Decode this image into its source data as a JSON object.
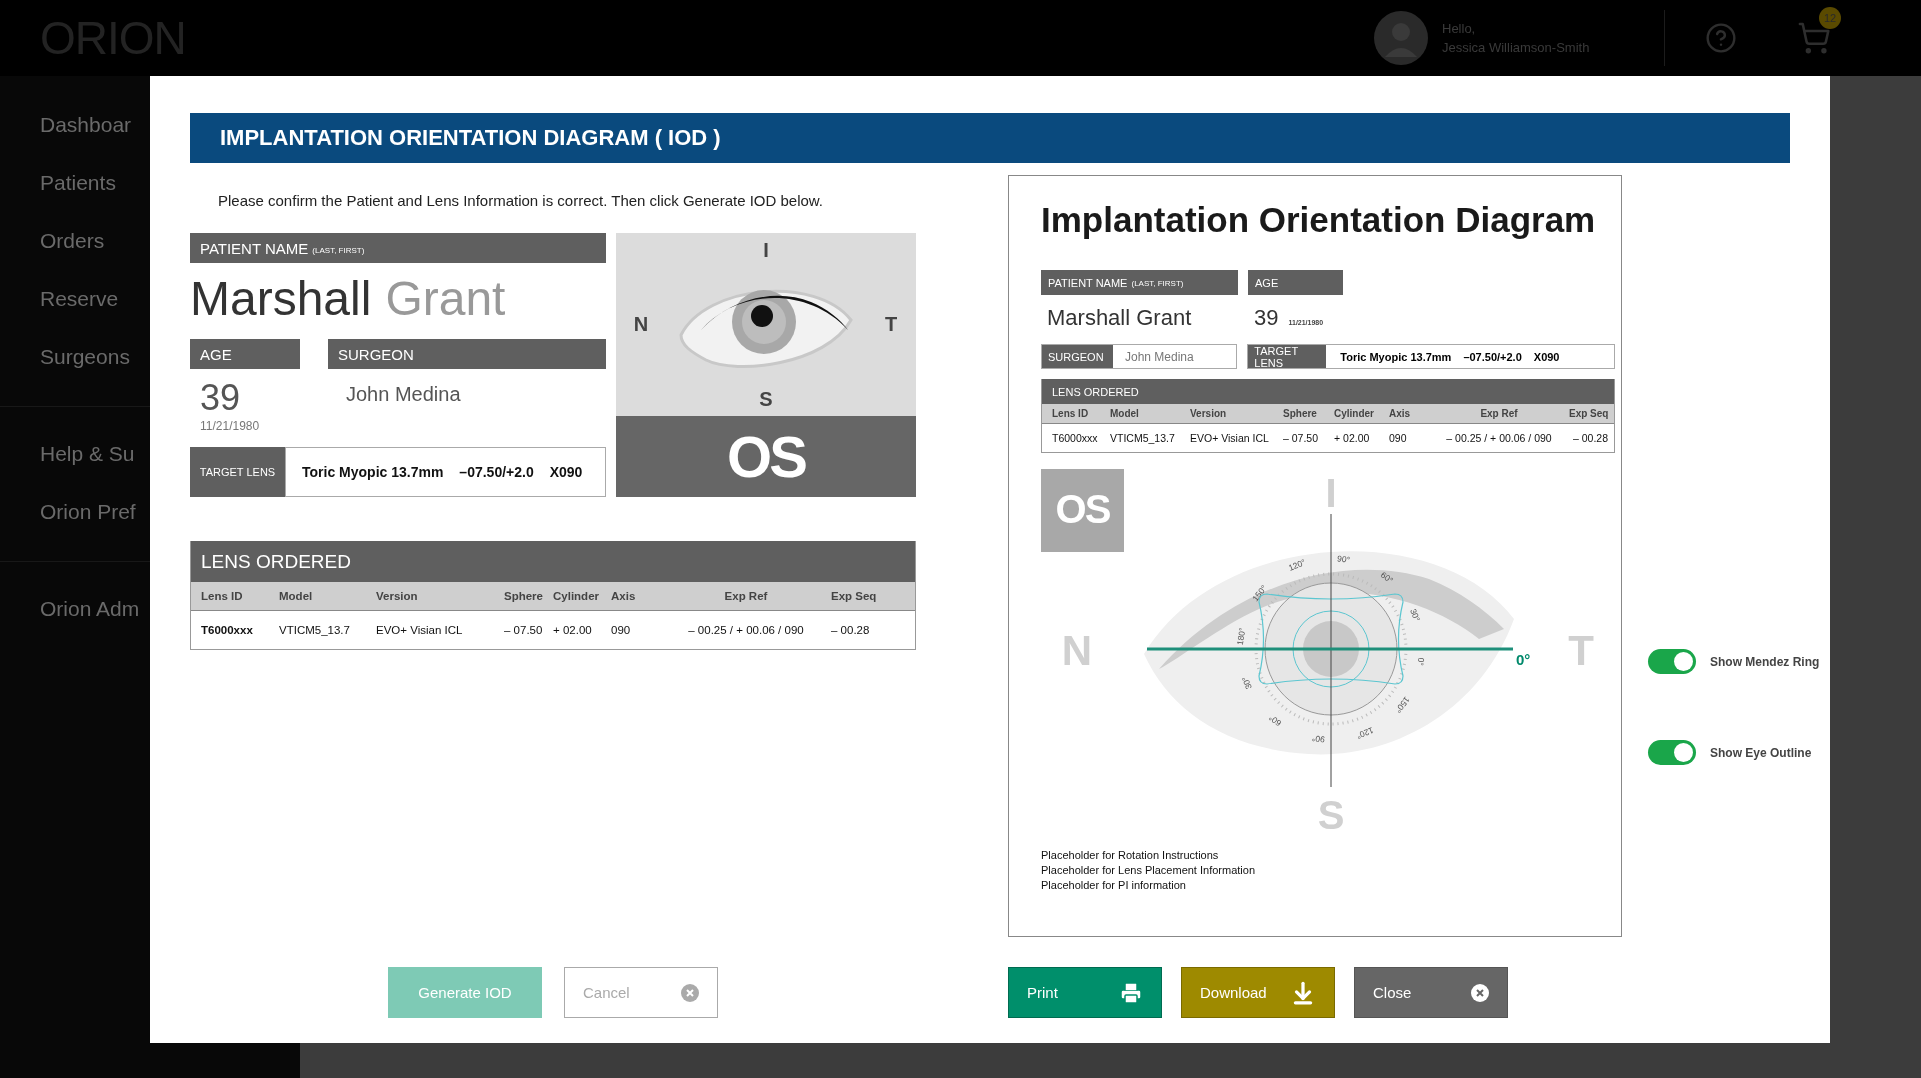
{
  "app": {
    "logo": "ORION",
    "greeting": "Hello,",
    "user_name": "Jessica Williamson-Smith",
    "cart_count": "12"
  },
  "sidebar": {
    "groups": [
      [
        "Dashboar",
        "Patients",
        "Orders",
        "Reserve",
        "Surgeons"
      ],
      [
        "Help & Su",
        "Orion Pref"
      ],
      [
        "Orion Adm"
      ]
    ]
  },
  "modal": {
    "title": "IMPLANTATION ORIENTATION DIAGRAM ( IOD )",
    "instructions": "Please confirm the Patient and Lens Information is correct. Then click Generate IOD below.",
    "patient": {
      "name_label": "PATIENT NAME",
      "name_hint": "(LAST, FIRST)",
      "last_name": "Marshall",
      "first_name": "Grant",
      "age_label": "AGE",
      "age": "39",
      "dob": "11/21/1980",
      "surgeon_label": "SURGEON",
      "surgeon": "John Medina",
      "target_label": "TARGET LENS",
      "target_parts": [
        "Toric Myopic 13.7mm",
        "–07.50/+2.0",
        "X090"
      ]
    },
    "eye_preview": {
      "top": "I",
      "left": "N",
      "right": "T",
      "bottom": "S",
      "eye": "OS"
    },
    "lens_table": {
      "title": "LENS ORDERED",
      "columns": [
        "Lens ID",
        "Model",
        "Version",
        "Sphere",
        "Cylinder",
        "Axis",
        "Exp Ref",
        "Exp Seq"
      ],
      "rows": [
        [
          "T6000xxx",
          "VTICM5_13.7",
          "EVO+ Visian ICL",
          "– 07.50",
          "+ 02.00",
          "090",
          "– 00.25 / + 00.06 / 090",
          "– 00.28"
        ]
      ]
    },
    "left_buttons": [
      {
        "label": "Generate IOD",
        "kind": "primary"
      },
      {
        "label": "Cancel",
        "kind": "cancel"
      }
    ],
    "diagram_card": {
      "title": "Implantation Orientation Diagram",
      "patient": {
        "name_label": "PATIENT NAME",
        "name_hint": "(LAST, FIRST)",
        "name": "Marshall Grant",
        "age_label": "AGE",
        "age": "39",
        "dob": "11/21/1980",
        "surgeon_label": "SURGEON",
        "surgeon": "John Medina",
        "target_label": "TARGET LENS",
        "target_parts": [
          "Toric Myopic 13.7mm",
          "–07.50/+2.0",
          "X090"
        ]
      },
      "lens_table": {
        "title": "LENS ORDERED",
        "columns": [
          "Lens ID",
          "Model",
          "Version",
          "Sphere",
          "Cylinder",
          "Axis",
          "Exp Ref",
          "Exp Seq"
        ],
        "rows": [
          [
            "T6000xxx",
            "VTICM5_13.7",
            "EVO+ Visian ICL",
            "– 07.50",
            "+ 02.00",
            "090",
            "– 00.25 / + 00.06 / 090",
            "– 00.28"
          ]
        ]
      },
      "diagram": {
        "eye": "OS",
        "top": "I",
        "bottom": "S",
        "left": "N",
        "right": "T",
        "axis_label": "0°",
        "ring_labels": [
          "90°",
          "60°",
          "30°",
          "0°",
          "150°",
          "120°",
          "90°",
          "60°",
          "30°",
          "180°",
          "150°",
          "120°"
        ]
      },
      "notes": [
        "Placeholder for Rotation Instructions",
        "Placeholder for Lens Placement Information",
        "Placeholder for PI information"
      ]
    },
    "toggles": [
      {
        "label": "Show Mendez Ring",
        "on": true
      },
      {
        "label": "Show Eye Outline",
        "on": true
      }
    ],
    "right_buttons": [
      {
        "label": "Print",
        "kind": "print"
      },
      {
        "label": "Download",
        "kind": "download"
      },
      {
        "label": "Close",
        "kind": "close"
      }
    ]
  }
}
